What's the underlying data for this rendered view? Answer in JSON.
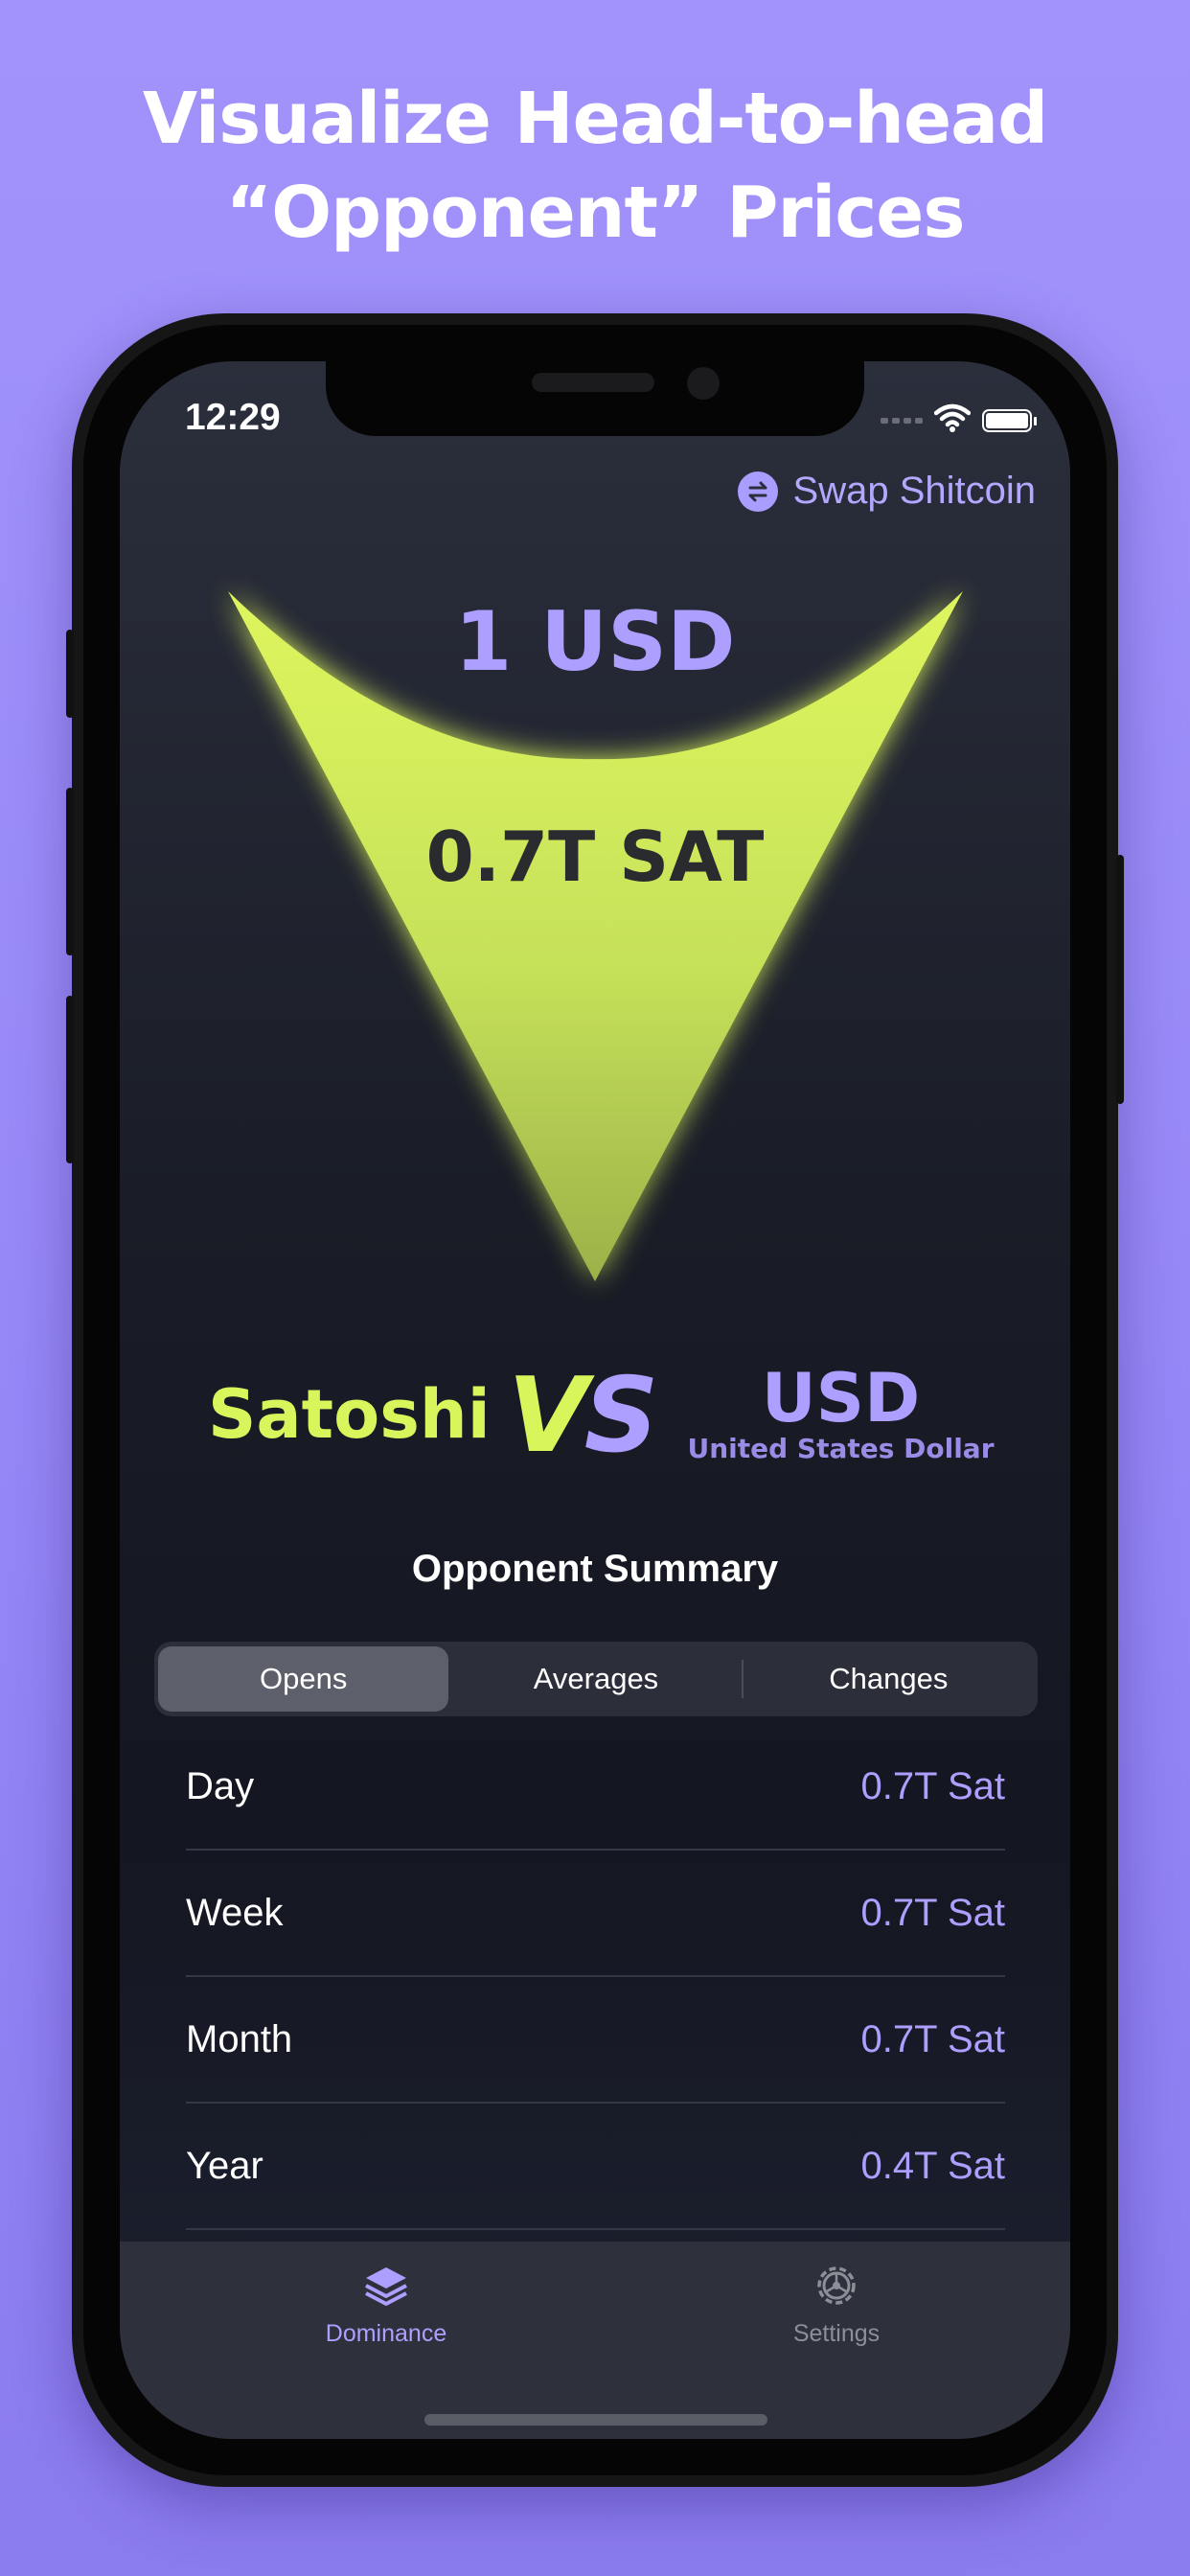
{
  "headline": {
    "line1": "Visualize Head-to-head",
    "line2": "“Opponent” Prices"
  },
  "status_bar": {
    "time": "12:29"
  },
  "header": {
    "swap_label": "Swap Shitcoin"
  },
  "comparison": {
    "top_amount": "1 USD",
    "mid_amount": "0.7T SAT",
    "left_opponent": "Satoshi",
    "vs_label_v": "V",
    "vs_label_s": "S",
    "right_opponent_code": "USD",
    "right_opponent_name": "United States Dollar"
  },
  "summary": {
    "title": "Opponent Summary",
    "tabs": [
      {
        "label": "Opens",
        "selected": true
      },
      {
        "label": "Averages",
        "selected": false
      },
      {
        "label": "Changes",
        "selected": false
      }
    ],
    "rows": [
      {
        "label": "Day",
        "value": "0.7T Sat"
      },
      {
        "label": "Week",
        "value": "0.7T Sat"
      },
      {
        "label": "Month",
        "value": "0.7T Sat"
      },
      {
        "label": "Year",
        "value": "0.4T Sat"
      }
    ]
  },
  "tab_bar": {
    "items": [
      {
        "label": "Dominance",
        "icon": "layers-icon",
        "active": true
      },
      {
        "label": "Settings",
        "icon": "gear-icon",
        "active": false
      }
    ]
  },
  "colors": {
    "accent_purple": "#ad9fff",
    "accent_lime": "#d8f55c",
    "background_purple": "#9d8ff9",
    "screen_dark": "#141621"
  }
}
